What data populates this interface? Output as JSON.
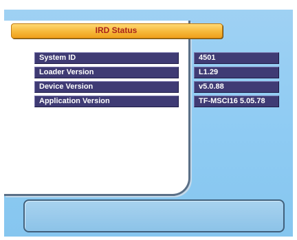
{
  "header": {
    "title": "IRD Status"
  },
  "info": {
    "rows": [
      {
        "label": "System ID",
        "value": "4501"
      },
      {
        "label": "Loader Version",
        "value": "L1.29"
      },
      {
        "label": "Device Version",
        "value": "v5.0.88"
      },
      {
        "label": "Application Version",
        "value": "TF-MSCI16 5.05.78"
      }
    ]
  },
  "message": {
    "text": ""
  },
  "colors": {
    "background": "#8ecbf3",
    "title_tab": "#f6b83a",
    "title_text": "#a9231a",
    "row_fill": "#3f3b74",
    "row_text": "#ffffff"
  }
}
